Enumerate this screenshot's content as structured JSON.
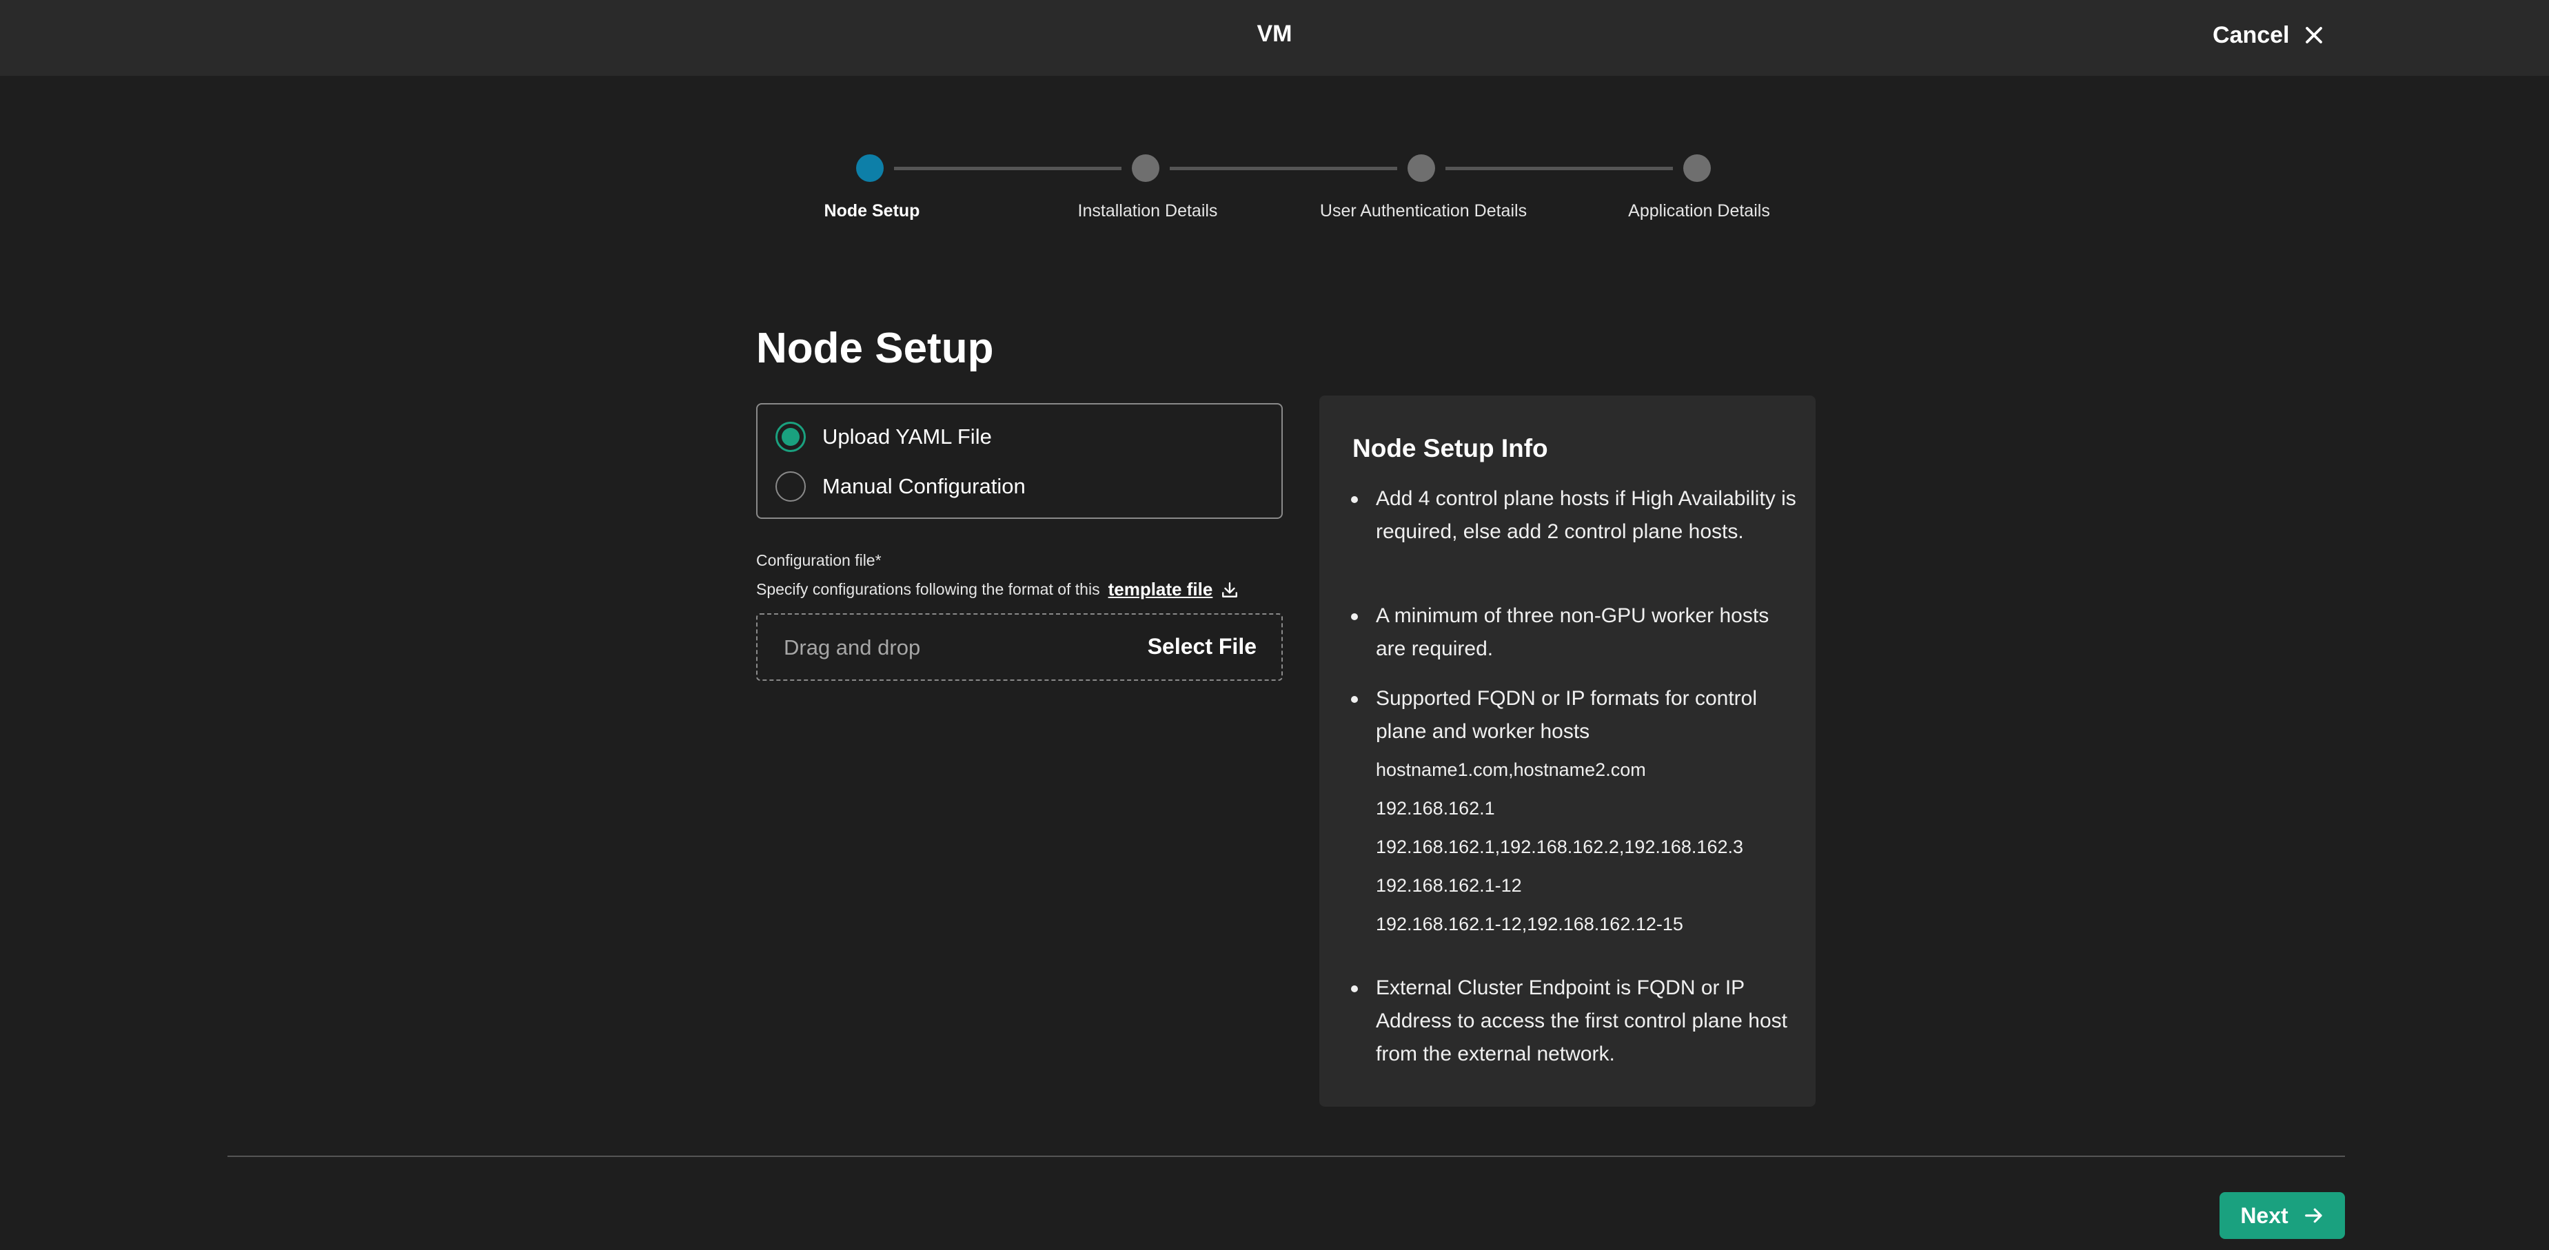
{
  "header": {
    "title": "VM",
    "cancel_label": "Cancel"
  },
  "stepper": {
    "steps": [
      {
        "label": "Node Setup",
        "active": true
      },
      {
        "label": "Installation Details",
        "active": false
      },
      {
        "label": "User Authentication Details",
        "active": false
      },
      {
        "label": "Application Details",
        "active": false
      }
    ]
  },
  "main": {
    "title": "Node Setup",
    "options": [
      {
        "label": "Upload YAML File",
        "selected": true
      },
      {
        "label": "Manual Configuration",
        "selected": false
      }
    ],
    "config_label": "Configuration file*",
    "config_help": "Specify configurations following the format of this",
    "template_link": "template file",
    "dropzone_placeholder": "Drag and drop",
    "select_file_label": "Select File"
  },
  "info": {
    "title": "Node Setup Info",
    "bullets": [
      "Add 4 control plane hosts if High Availability is required, else add 2 control plane hosts.",
      "A minimum of three non-GPU worker hosts are required.",
      "Supported FQDN or IP formats for control plane and worker hosts",
      "External Cluster Endpoint is FQDN or IP Address to access the first control plane host from the external network."
    ],
    "examples": [
      "hostname1.com,hostname2.com",
      "192.168.162.1",
      "192.168.162.1,192.168.162.2,192.168.162.3",
      "192.168.162.1-12",
      "192.168.162.1-12,192.168.162.12-15"
    ]
  },
  "footer": {
    "next_label": "Next"
  },
  "colors": {
    "accent": "#1aa17f",
    "active_step": "#0d7fa8",
    "background": "#1e1e1e"
  }
}
